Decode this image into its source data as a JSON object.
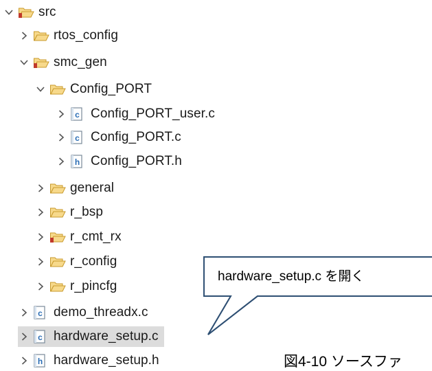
{
  "tree": [
    {
      "label": "src",
      "type": "source-folder",
      "expanded": true
    },
    {
      "label": "rtos_config",
      "type": "folder",
      "expanded": false
    },
    {
      "label": "smc_gen",
      "type": "source-folder",
      "expanded": true
    },
    {
      "label": "Config_PORT",
      "type": "folder",
      "expanded": true
    },
    {
      "label": "Config_PORT_user.c",
      "type": "c-file",
      "expanded": false
    },
    {
      "label": "Config_PORT.c",
      "type": "c-file",
      "expanded": false
    },
    {
      "label": "Config_PORT.h",
      "type": "h-file",
      "expanded": false
    },
    {
      "label": "general",
      "type": "folder",
      "expanded": false
    },
    {
      "label": "r_bsp",
      "type": "folder",
      "expanded": false
    },
    {
      "label": "r_cmt_rx",
      "type": "source-folder",
      "expanded": false
    },
    {
      "label": "r_config",
      "type": "folder",
      "expanded": false
    },
    {
      "label": "r_pincfg",
      "type": "folder",
      "expanded": false
    },
    {
      "label": "demo_threadx.c",
      "type": "c-file",
      "expanded": false
    },
    {
      "label": "hardware_setup.c",
      "type": "c-file",
      "expanded": false,
      "selected": true
    },
    {
      "label": "hardware_setup.h",
      "type": "h-file",
      "expanded": false
    }
  ],
  "callout": {
    "text": "hardware_setup.c を開く"
  },
  "caption": {
    "text": "図4-10 ソースファ"
  },
  "colors": {
    "folder_fill": "#f7d98b",
    "folder_stroke": "#c89a2c",
    "source_marker": "#c0392b",
    "c_letter": "#2a6db5",
    "h_letter": "#2a6db5",
    "file_stroke": "#7a8a99",
    "chevron": "#555555",
    "selection": "#dcdcdc"
  }
}
